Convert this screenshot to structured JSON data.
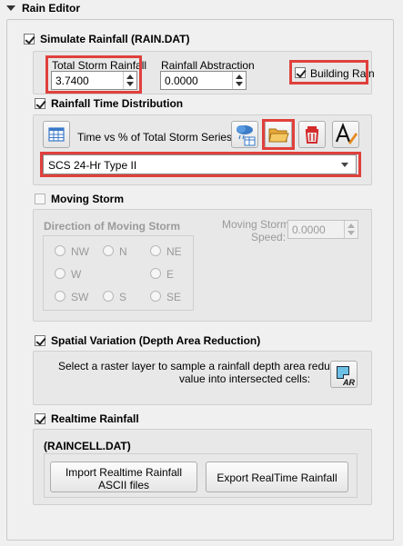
{
  "panel": {
    "title": "Rain Editor"
  },
  "simulate": {
    "label": "Simulate Rainfall  (RAIN.DAT)",
    "checked": true
  },
  "storm": {
    "total_label": "Total Storm Rainfall",
    "total_value": "3.7400",
    "abstraction_label": "Rainfall Abstraction",
    "abstraction_value": "0.0000",
    "building_rain_label": "Building Rain",
    "building_rain_checked": true
  },
  "distribution": {
    "label": "Rainfall Time Distribution",
    "series_label": "Time vs % of Total Storm Series",
    "selected_series": "SCS 24-Hr Type II",
    "icons": [
      "table-icon",
      "rain-cloud-icon",
      "open-folder-icon",
      "trash-icon",
      "rename-text-icon"
    ]
  },
  "moving_storm": {
    "label": "Moving Storm",
    "direction_label": "Direction of Moving Storm",
    "speed_label_1": "Moving Storm",
    "speed_label_2": "Speed:",
    "speed_value": "0.0000",
    "directions": [
      "NW",
      "N",
      "NE",
      "W",
      "E",
      "SW",
      "S",
      "SE"
    ]
  },
  "spatial": {
    "label": "Spatial Variation (Depth Area Reduction)",
    "desc_1": "Select a raster layer to sample a rainfall depth area reduction",
    "desc_2": "value into intersected cells:",
    "icon_text": "AR"
  },
  "realtime": {
    "label": "Realtime Rainfall",
    "file_label": "(RAINCELL.DAT)",
    "import_label_1": "Import Realtime Rainfall",
    "import_label_2": "ASCII files",
    "export_label": "Export RealTime Rainfall"
  },
  "colors": {
    "highlight": "#e0403c",
    "panel_bg": "#f0f0f0",
    "group_bg": "#e8e8e8"
  }
}
